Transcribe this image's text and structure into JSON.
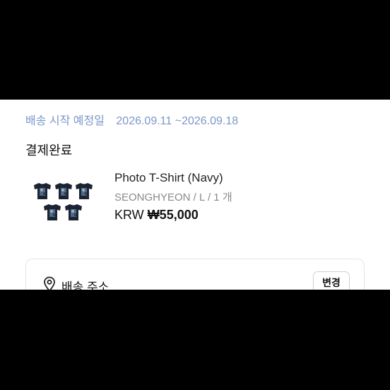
{
  "shipping": {
    "label": "배송 시작 예정일",
    "range": "2026.09.11 ~2026.09.18"
  },
  "order": {
    "status": "결제완료",
    "product_name": "Photo T-Shirt (Navy)",
    "options": "SEONGHYEON / L / 1 개",
    "currency": "KRW",
    "price": "₩55,000",
    "thumbnail_icon": "tshirt-photo-thumbnail"
  },
  "address": {
    "icon": "location-pin-icon",
    "label": "배송 주소",
    "change_label": "변경"
  },
  "colors": {
    "ship_date": "#7b97c8",
    "shirt": "#1c2433"
  }
}
